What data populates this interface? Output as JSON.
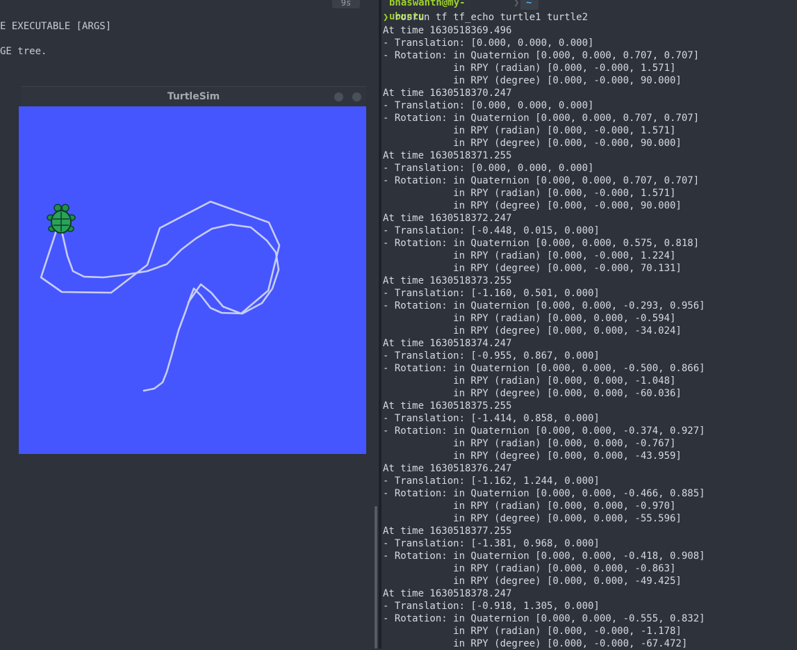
{
  "left_pane": {
    "badge": "9s",
    "usage_line": "E EXECUTABLE [ARGS]",
    "tree_line": "GE tree."
  },
  "turtlesim": {
    "title": "TurtleSim",
    "background": "#4556ff",
    "path_color": "#c8cdf5"
  },
  "terminal": {
    "user_host": "bhaswanth@my-ubuntu",
    "dir": "~",
    "prompt_glyph": "❯",
    "command": "rosrun tf tf_echo turtle1 turtle2",
    "records": [
      {
        "time": "At time 1630518369.496",
        "translation": "- Translation: [0.000, 0.000, 0.000]",
        "quaternion": "- Rotation: in Quaternion [0.000, 0.000, 0.707, 0.707]",
        "rpy_rad": "            in RPY (radian) [0.000, -0.000, 1.571]",
        "rpy_deg": "            in RPY (degree) [0.000, -0.000, 90.000]"
      },
      {
        "time": "At time 1630518370.247",
        "translation": "- Translation: [0.000, 0.000, 0.000]",
        "quaternion": "- Rotation: in Quaternion [0.000, 0.000, 0.707, 0.707]",
        "rpy_rad": "            in RPY (radian) [0.000, -0.000, 1.571]",
        "rpy_deg": "            in RPY (degree) [0.000, -0.000, 90.000]"
      },
      {
        "time": "At time 1630518371.255",
        "translation": "- Translation: [0.000, 0.000, 0.000]",
        "quaternion": "- Rotation: in Quaternion [0.000, 0.000, 0.707, 0.707]",
        "rpy_rad": "            in RPY (radian) [0.000, -0.000, 1.571]",
        "rpy_deg": "            in RPY (degree) [0.000, -0.000, 90.000]"
      },
      {
        "time": "At time 1630518372.247",
        "translation": "- Translation: [-0.448, 0.015, 0.000]",
        "quaternion": "- Rotation: in Quaternion [0.000, 0.000, 0.575, 0.818]",
        "rpy_rad": "            in RPY (radian) [0.000, -0.000, 1.224]",
        "rpy_deg": "            in RPY (degree) [0.000, -0.000, 70.131]"
      },
      {
        "time": "At time 1630518373.255",
        "translation": "- Translation: [-1.160, 0.501, 0.000]",
        "quaternion": "- Rotation: in Quaternion [0.000, 0.000, -0.293, 0.956]",
        "rpy_rad": "            in RPY (radian) [0.000, 0.000, -0.594]",
        "rpy_deg": "            in RPY (degree) [0.000, 0.000, -34.024]"
      },
      {
        "time": "At time 1630518374.247",
        "translation": "- Translation: [-0.955, 0.867, 0.000]",
        "quaternion": "- Rotation: in Quaternion [0.000, 0.000, -0.500, 0.866]",
        "rpy_rad": "            in RPY (radian) [0.000, 0.000, -1.048]",
        "rpy_deg": "            in RPY (degree) [0.000, 0.000, -60.036]"
      },
      {
        "time": "At time 1630518375.255",
        "translation": "- Translation: [-1.414, 0.858, 0.000]",
        "quaternion": "- Rotation: in Quaternion [0.000, 0.000, -0.374, 0.927]",
        "rpy_rad": "            in RPY (radian) [0.000, 0.000, -0.767]",
        "rpy_deg": "            in RPY (degree) [0.000, 0.000, -43.959]"
      },
      {
        "time": "At time 1630518376.247",
        "translation": "- Translation: [-1.162, 1.244, 0.000]",
        "quaternion": "- Rotation: in Quaternion [0.000, 0.000, -0.466, 0.885]",
        "rpy_rad": "            in RPY (radian) [0.000, 0.000, -0.970]",
        "rpy_deg": "            in RPY (degree) [0.000, 0.000, -55.596]"
      },
      {
        "time": "At time 1630518377.255",
        "translation": "- Translation: [-1.381, 0.968, 0.000]",
        "quaternion": "- Rotation: in Quaternion [0.000, 0.000, -0.418, 0.908]",
        "rpy_rad": "            in RPY (radian) [0.000, 0.000, -0.863]",
        "rpy_deg": "            in RPY (degree) [0.000, 0.000, -49.425]"
      },
      {
        "time": "At time 1630518378.247",
        "translation": "- Translation: [-0.918, 1.305, 0.000]",
        "quaternion": "- Rotation: in Quaternion [0.000, 0.000, -0.555, 0.832]",
        "rpy_rad": "            in RPY (radian) [0.000, -0.000, -1.178]",
        "rpy_deg": "            in RPY (degree) [0.000, -0.000, -67.472]"
      }
    ]
  }
}
